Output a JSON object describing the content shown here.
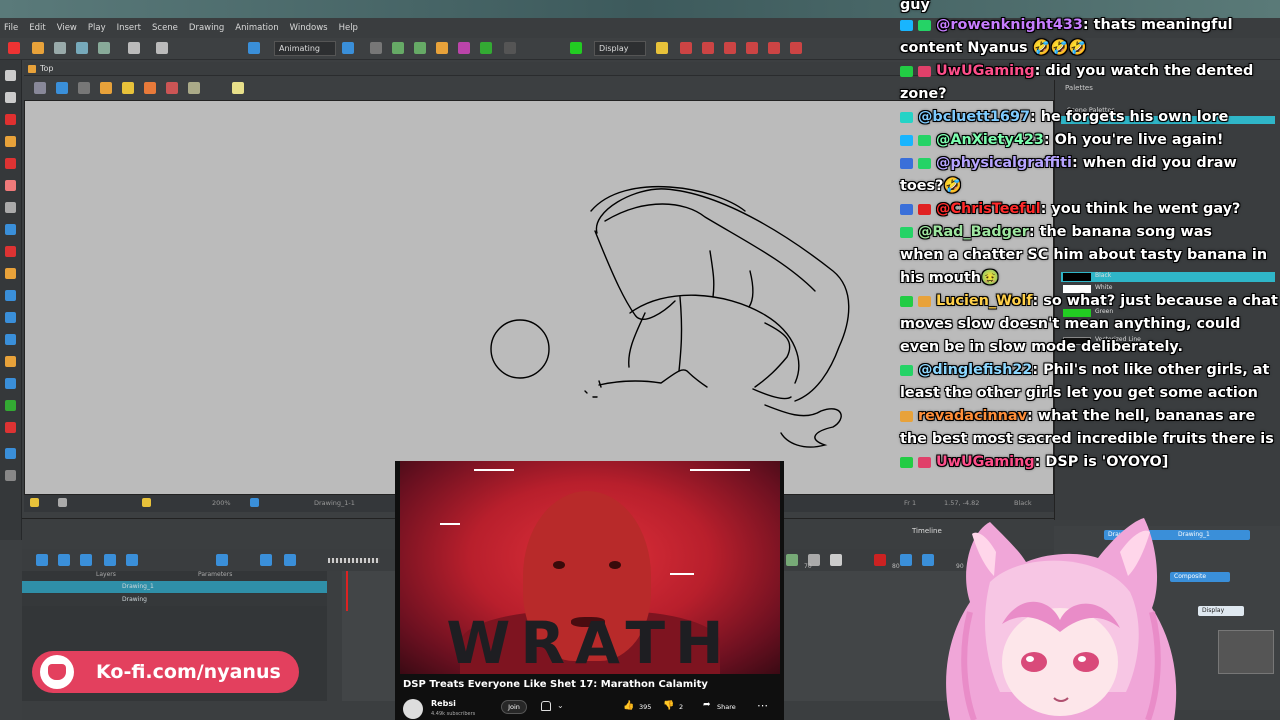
{
  "app": {
    "menu": [
      "File",
      "Edit",
      "View",
      "Play",
      "Insert",
      "Scene",
      "Drawing",
      "Animation",
      "Windows",
      "Help"
    ],
    "toolbar": {
      "mode": "Animating",
      "display": "Display"
    },
    "view_title": "Top",
    "status": {
      "zoom": "200%",
      "drawing": "Drawing_1-1",
      "frame": "Fr 1",
      "coords": "1.57, -4.82",
      "color": "Black"
    },
    "layers_header": "Layers",
    "parameters_header": "Parameters",
    "layers": [
      {
        "name": "Drawing_1"
      },
      {
        "name": "Drawing"
      }
    ],
    "timeline_tab": "Timeline",
    "frame_numbers": [
      "70",
      "80",
      "90"
    ],
    "palettes_tab": "Palettes",
    "scene_palettes": "Scene Palettes",
    "swatches": [
      {
        "name": "Black",
        "color": "#000000"
      },
      {
        "name": "White",
        "color": "#ffffff"
      },
      {
        "name": "Green",
        "color": "#22cc22"
      },
      {
        "name": "Vectorized Line",
        "color": "#111111"
      }
    ],
    "nodes": [
      "Drawing",
      "Drawing_1",
      "Composite",
      "Display"
    ]
  },
  "chat": {
    "lines": [
      {
        "user": "",
        "text": "guy",
        "color": "#ffffff"
      },
      {
        "user": "@rowenknight433",
        "text": ": thats meaningful",
        "color": "#c77dff"
      },
      {
        "user": "",
        "text": "content Nyanus 🤣🤣🤣",
        "color": "#ffffff"
      },
      {
        "user": "UwUGaming",
        "text": ": did you watch the dented",
        "color": "#ff4f8b"
      },
      {
        "user": "",
        "text": "zone?",
        "color": "#ffffff"
      },
      {
        "user": "@bcluett1697",
        "text": ": he forgets his own lore",
        "color": "#7ecbff"
      },
      {
        "user": "@AnXiety423",
        "text": ": Oh you're live again!",
        "color": "#7dffb0"
      },
      {
        "user": "@physicalgraffiti",
        "text": ": when did you draw",
        "color": "#b6a4ff"
      },
      {
        "user": "",
        "text": "toes?🤣",
        "color": "#ffffff"
      },
      {
        "user": "@ChrisTeeful",
        "text": ": you think he went gay?",
        "color": "#ff2a2a"
      },
      {
        "user": "@Rad_Badger",
        "text": ": the banana song was",
        "color": "#9ee6a0"
      },
      {
        "user": "",
        "text": "when a chatter SC him about tasty banana in",
        "color": "#ffffff"
      },
      {
        "user": "",
        "text": "his mouth🤢",
        "color": "#ffffff"
      },
      {
        "user": "Lucien_Wolf",
        "text": ": so what? just because a chat",
        "color": "#ffd04a"
      },
      {
        "user": "",
        "text": "moves slow doesn't mean anything, could",
        "color": "#ffffff"
      },
      {
        "user": "",
        "text": "even be in slow mode deliberately.",
        "color": "#ffffff"
      },
      {
        "user": "@dinglefish22",
        "text": ": Phil's not like other girls, at",
        "color": "#8dd8ff"
      },
      {
        "user": "",
        "text": "least the other girls let you get some action",
        "color": "#ffffff"
      },
      {
        "user": "revadacinnav",
        "text": ": what the hell, bananas are",
        "color": "#ff8f3a"
      },
      {
        "user": "",
        "text": "the best most sacred incredible fruits there is",
        "color": "#ffffff"
      },
      {
        "user": "UwUGaming",
        "text": ": DSP is 'OYOYO]",
        "color": "#ff4f8b"
      }
    ]
  },
  "video": {
    "thumbnail_text": "WRATH",
    "title": "DSP Treats Everyone Like Shet 17: Marathon Calamity",
    "channel": "Rebsi",
    "subscribers": "4.49k subscribers",
    "join": "Join",
    "likes": "395",
    "dislikes": "2",
    "share": "Share"
  },
  "kofi": {
    "text": "Ko-fi.com/nyanus",
    "color": "#e3405e"
  }
}
